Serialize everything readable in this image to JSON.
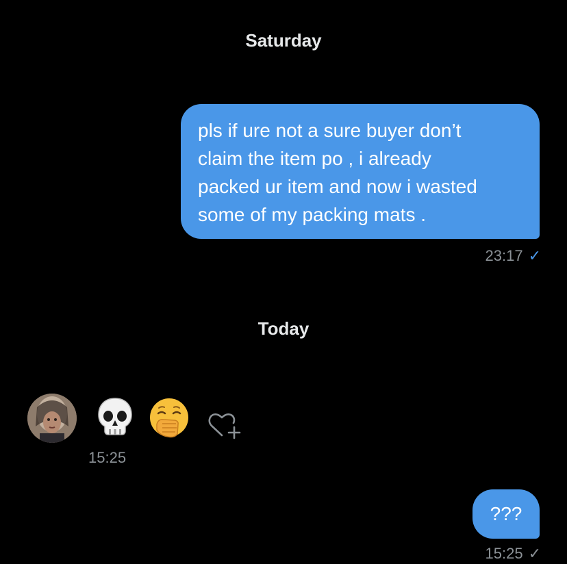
{
  "conversation": {
    "day_separators": {
      "first": "Saturday",
      "second": "Today"
    },
    "messages": [
      {
        "direction": "outgoing",
        "text": "pls if ure not a sure buyer don’t\nclaim the item po , i already\npacked ur item and now i wasted\nsome of my packing mats .",
        "time": "23:17",
        "status_icon": "check-icon",
        "status_color": "#4a97e8"
      },
      {
        "direction": "incoming",
        "emojis": [
          "💀",
          "🥱"
        ],
        "time": "15:25",
        "reaction_icon": "add-reaction-icon"
      },
      {
        "direction": "outgoing",
        "text": "???",
        "time": "15:25",
        "status_icon": "check-icon",
        "status_color": "#8b9196"
      }
    ]
  },
  "colors": {
    "background": "#000000",
    "outgoing_bubble": "#4a97e8",
    "meta_text": "#8b9196"
  }
}
